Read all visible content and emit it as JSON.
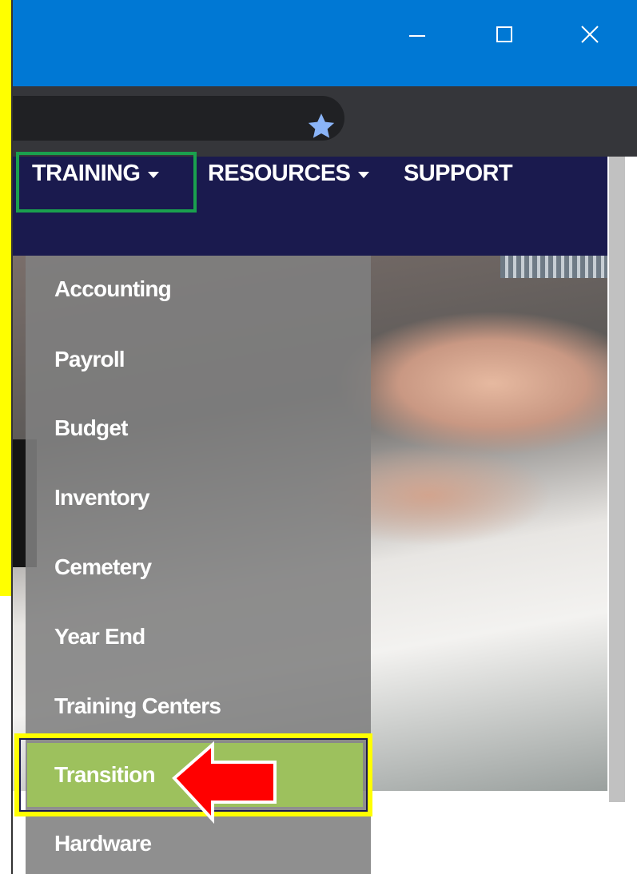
{
  "window": {
    "controls": [
      "minimize-icon",
      "maximize-icon",
      "close-icon"
    ],
    "accent": "#0078d4"
  },
  "address_bar": {
    "bookmark_icon": "star-icon",
    "star_color": "#8ab4f8"
  },
  "nav": {
    "items": [
      {
        "label": "TRAINING",
        "has_caret": true,
        "highlighted": true
      },
      {
        "label": "RESOURCES",
        "has_caret": true
      },
      {
        "label": "SUPPORT",
        "has_caret": false
      }
    ],
    "background": "#1a1a4e",
    "highlight_color": "#1aa04e"
  },
  "dropdown": {
    "items": [
      {
        "label": "Accounting"
      },
      {
        "label": "Payroll"
      },
      {
        "label": "Budget"
      },
      {
        "label": "Inventory"
      },
      {
        "label": "Cemetery"
      },
      {
        "label": "Year End"
      },
      {
        "label": "Training Centers"
      },
      {
        "label": "Transition",
        "active": true
      },
      {
        "label": "Hardware"
      }
    ],
    "active_color": "#9dc15d",
    "annotation_box_color": "#ffff00",
    "annotation_arrow_color": "#ff0000"
  }
}
